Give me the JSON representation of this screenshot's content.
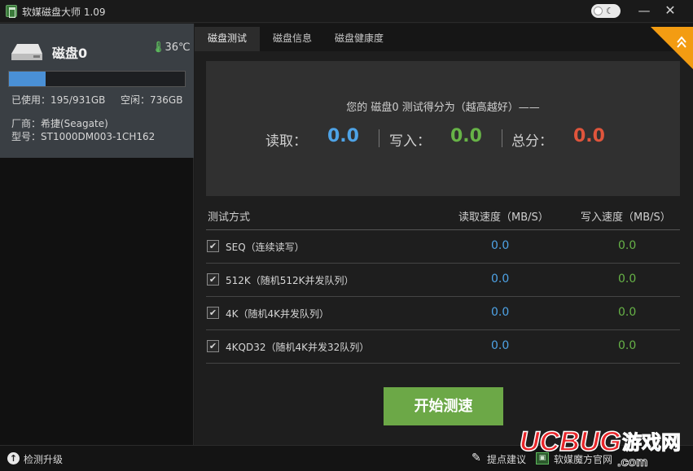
{
  "window": {
    "title": "软媒磁盘大师 1.09",
    "min_glyph": "—",
    "close_glyph": "✕"
  },
  "sidebar": {
    "disk_name": "磁盘0",
    "temperature": "36℃",
    "usage_fraction": 0.2095,
    "used_text": "已使用：195/931GB",
    "free_text": "空闲：736GB",
    "vendor_text": "厂商：希捷(Seagate)",
    "model_text": "型号：ST1000DM003-1CH162"
  },
  "tabs": [
    {
      "label": "磁盘测试",
      "active": true
    },
    {
      "label": "磁盘信息",
      "active": false
    },
    {
      "label": "磁盘健康度",
      "active": false
    }
  ],
  "score": {
    "caption": "您的 磁盘0 测试得分为（越高越好）——",
    "read_label": "读取：",
    "read_value": "0.0",
    "write_label": "写入：",
    "write_value": "0.0",
    "total_label": "总分：",
    "total_value": "0.0"
  },
  "tests": {
    "headers": {
      "method": "测试方式",
      "read": "读取速度（MB/S）",
      "write": "写入速度（MB/S）"
    },
    "rows": [
      {
        "label": "SEQ（连续读写）",
        "read": "0.0",
        "write": "0.0",
        "checked": true
      },
      {
        "label": "512K（随机512K并发队列）",
        "read": "0.0",
        "write": "0.0",
        "checked": true
      },
      {
        "label": "4K（随机4K并发队列）",
        "read": "0.0",
        "write": "0.0",
        "checked": true
      },
      {
        "label": "4KQD32（随机4K并发32队列）",
        "read": "0.0",
        "write": "0.0",
        "checked": true
      }
    ]
  },
  "start_button": "开始测速",
  "statusbar": {
    "update": "检测升级",
    "suggest": "提点建议",
    "site": "软媒魔方官网"
  },
  "watermark": {
    "logo_text": "UCBUG",
    "cn_text": "游戏网",
    "domain": ".com"
  },
  "colors": {
    "read": "#4ea3e6",
    "write": "#67b347",
    "total": "#e0553c",
    "button": "#6ca847",
    "badge": "#f39c12"
  }
}
